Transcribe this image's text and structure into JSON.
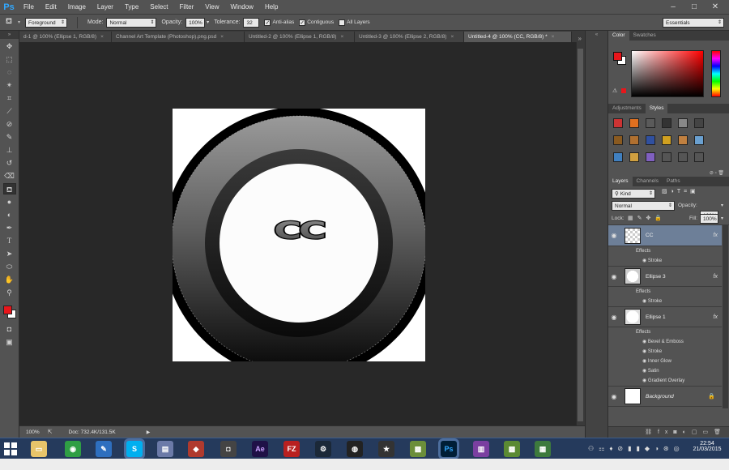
{
  "app": {
    "logo": "Ps"
  },
  "menu": [
    "File",
    "Edit",
    "Image",
    "Layer",
    "Type",
    "Select",
    "Filter",
    "View",
    "Window",
    "Help"
  ],
  "window_controls": [
    "–",
    "□",
    "✕"
  ],
  "options": {
    "fill_source": "Foreground",
    "mode_label": "Mode:",
    "mode_value": "Normal",
    "opacity_label": "Opacity:",
    "opacity_value": "100%",
    "tolerance_label": "Tolerance:",
    "tolerance_value": "32",
    "antialias_label": "Anti-alias",
    "contiguous_label": "Contiguous",
    "all_layers_label": "All Layers",
    "workspace": "Essentials"
  },
  "doc_tabs": [
    {
      "label": "d-1 @ 100% (Ellipse 1, RGB/8)",
      "active": false
    },
    {
      "label": "Channel Art Template (Photoshop).png.psd",
      "active": false
    },
    {
      "label": "Untitled-2 @ 100% (Ellipse 1, RGB/8)",
      "active": false
    },
    {
      "label": "Untitled-3 @ 100% (Ellipse 2, RGB/8)",
      "active": false
    },
    {
      "label": "Untitled-4 @ 100% (CC, RGB/8) *",
      "active": true
    }
  ],
  "canvas": {
    "logo_text": "CC"
  },
  "status": {
    "zoom": "100%",
    "doc_info": "Doc: 732.4K/131.5K"
  },
  "color_panel": {
    "tabs": [
      "Color",
      "Swatches"
    ]
  },
  "adjust_panel": {
    "tabs": [
      "Adjustments",
      "Styles"
    ]
  },
  "layers_panel": {
    "tabs": [
      "Layers",
      "Channels",
      "Paths"
    ],
    "filter_kind": "Kind",
    "blend_mode": "Normal",
    "opacity_label": "Opacity:",
    "opacity_value": "100%",
    "lock_label": "Lock:",
    "fill_label": "Fill:",
    "fill_value": "100%",
    "layers": [
      {
        "name": "CC",
        "selected": true,
        "effects_label": "Effects",
        "effects": [
          "Stroke"
        ]
      },
      {
        "name": "Ellipse 3",
        "selected": false,
        "effects_label": "Effects",
        "effects": [
          "Stroke"
        ]
      },
      {
        "name": "Ellipse 1",
        "selected": false,
        "effects_label": "Effects",
        "effects": [
          "Bevel & Emboss",
          "Stroke",
          "Inner Glow",
          "Satin",
          "Gradient Overlay"
        ]
      },
      {
        "name": "Background",
        "selected": false
      }
    ]
  },
  "taskbar": {
    "time": "22:54",
    "date": "21/03/2015",
    "app_labels": [
      "Ae",
      "FZ",
      "Ps"
    ]
  }
}
